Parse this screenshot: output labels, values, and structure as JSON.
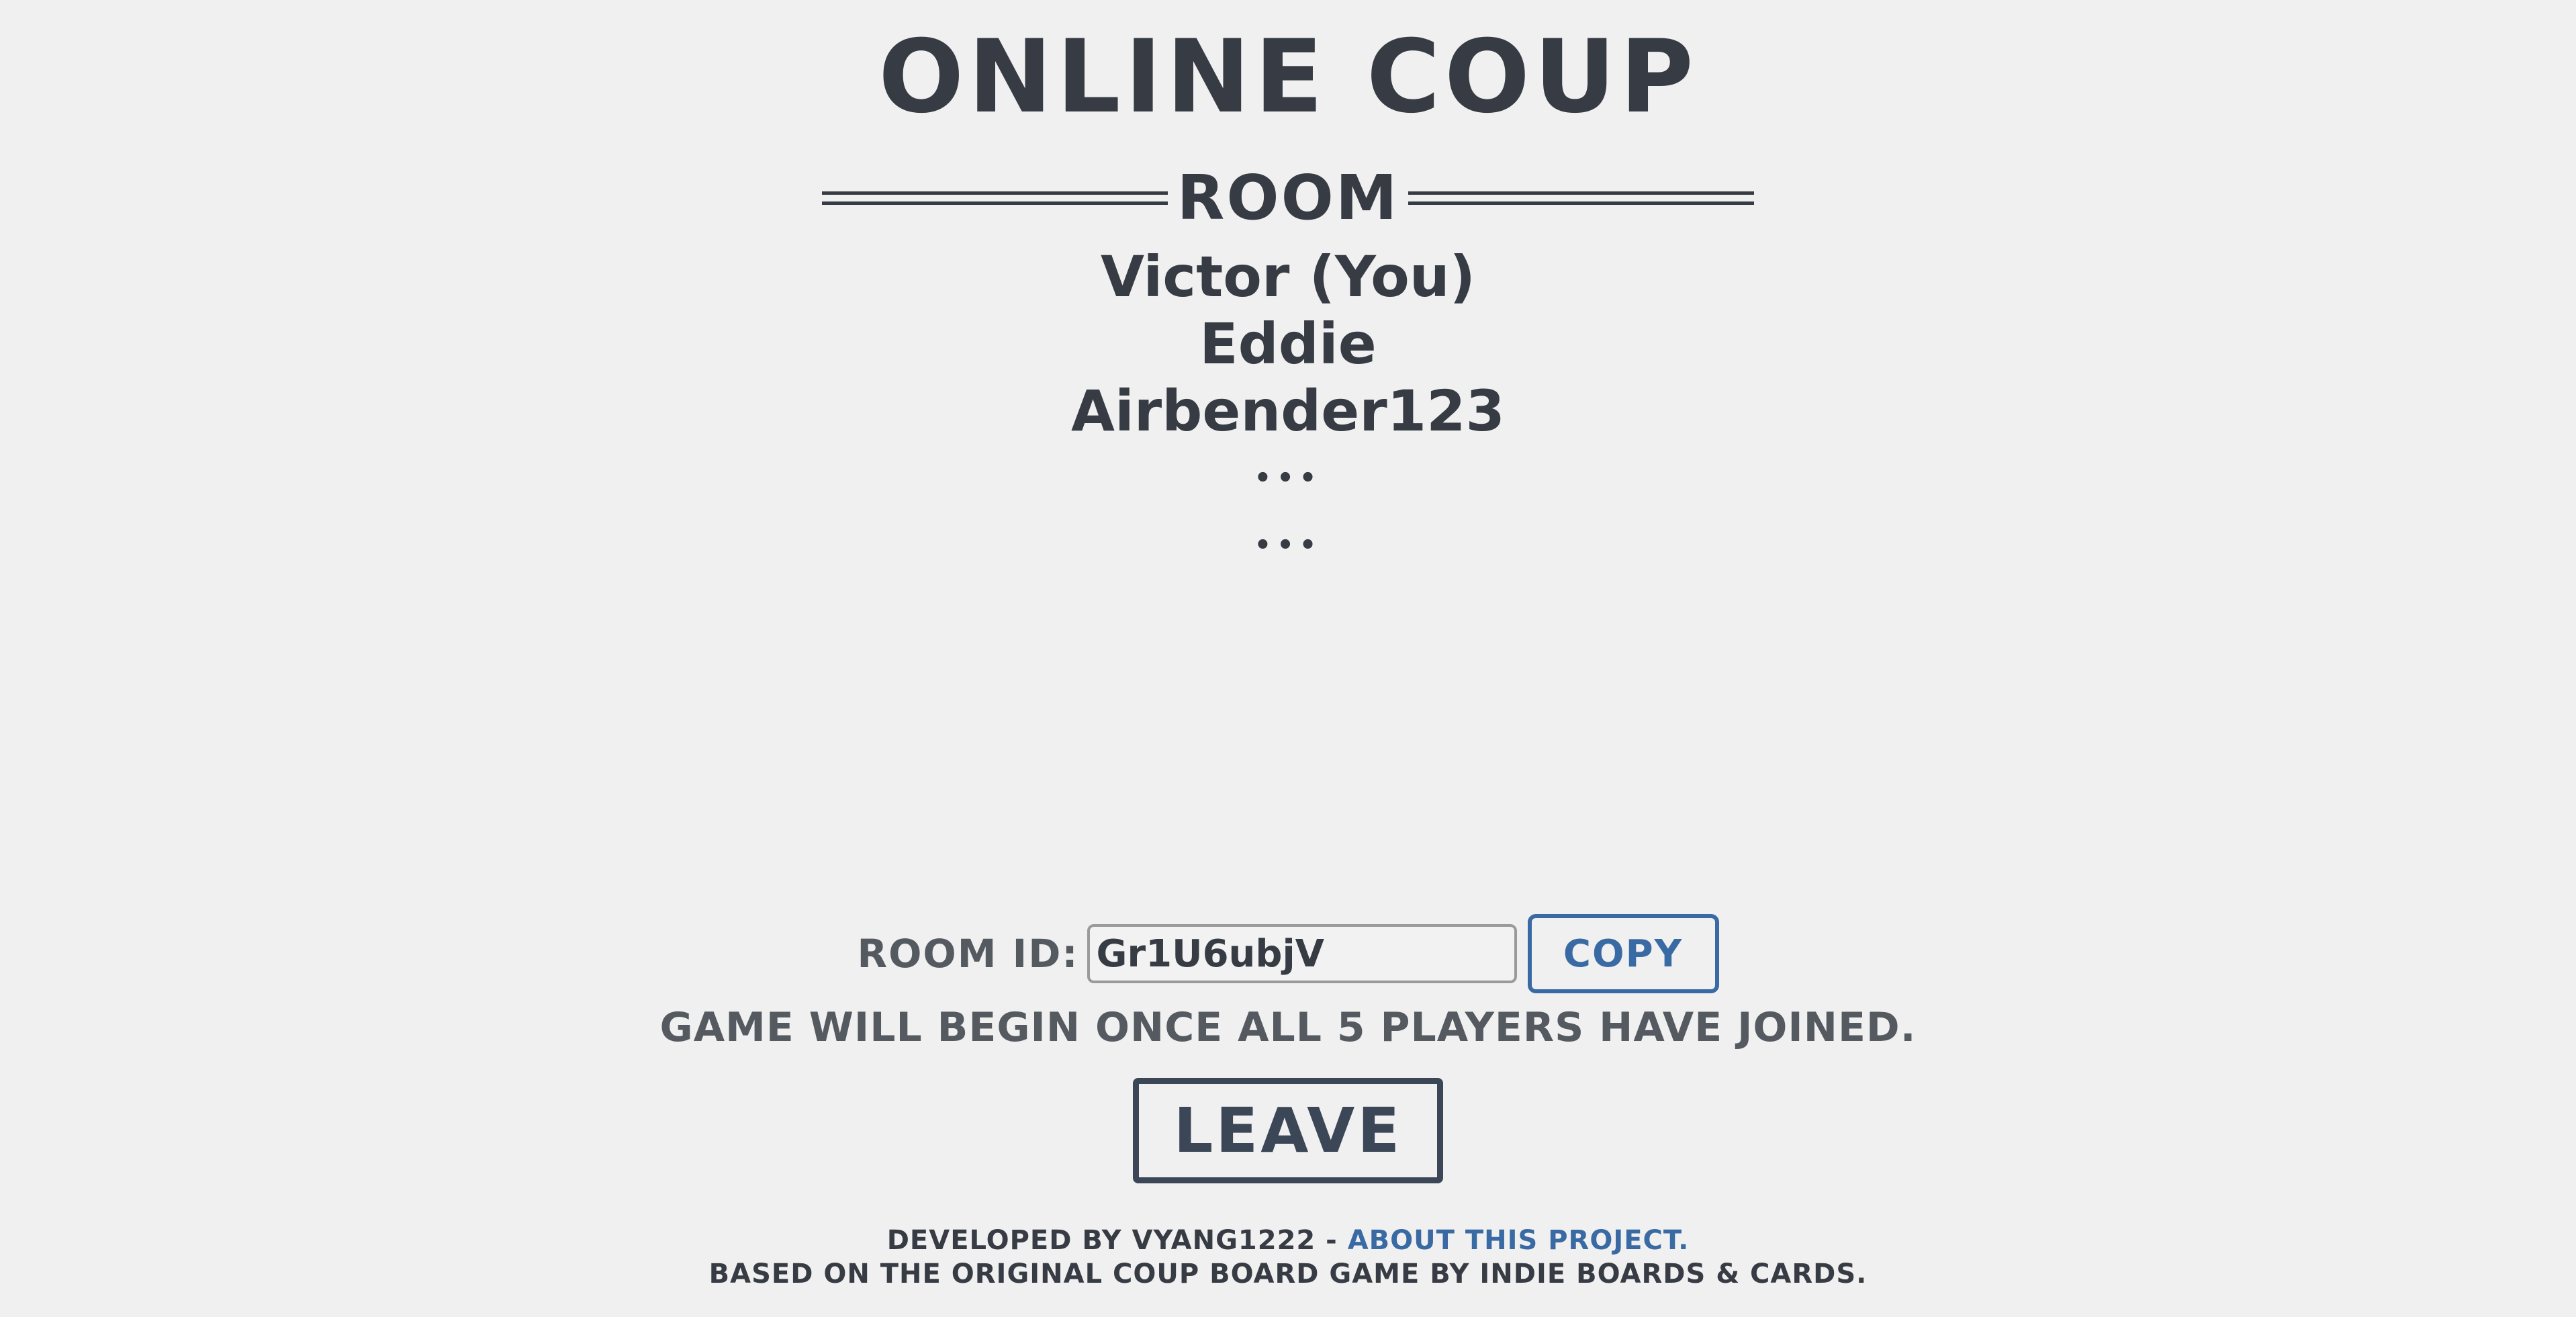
{
  "app": {
    "title": "ONLINE COUP"
  },
  "room": {
    "heading": "ROOM",
    "players": [
      "Victor (You)",
      "Eddie",
      "Airbender123"
    ],
    "empty_slots": [
      "•••",
      "•••"
    ],
    "room_id_label": "ROOM ID:",
    "room_id_value": "Gr1U6ubjV",
    "copy_label": "COPY",
    "status": "GAME WILL BEGIN ONCE ALL 5 PLAYERS HAVE JOINED.",
    "leave_label": "LEAVE"
  },
  "footer": {
    "developed_by": "DEVELOPED BY VYANG1222 - ",
    "about_link": "ABOUT THIS PROJECT.",
    "credit": "BASED ON THE ORIGINAL COUP BOARD GAME BY INDIE BOARDS & CARDS."
  },
  "colors": {
    "background": "#f0f0f0",
    "text_dark": "#373c44",
    "text_muted": "#555a61",
    "accent_blue": "#3a6aa3"
  }
}
